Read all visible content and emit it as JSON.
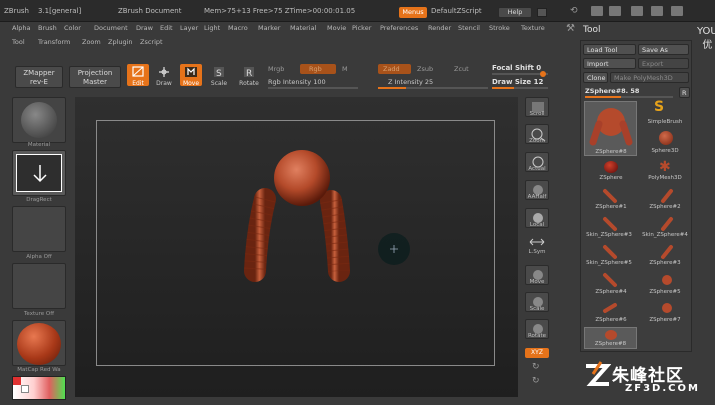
{
  "titlebar": {
    "app": "ZBrush",
    "version": "3.1[general]",
    "doc": "ZBrush Document",
    "mem": "Mem>75+13 Free>75 ZTime>00:00:01.05",
    "menus_btn": "Menus",
    "default_script": "DefaultZScript",
    "help": "Help"
  },
  "menubar": [
    "Alpha",
    "Brush",
    "Color",
    "Document",
    "Draw",
    "Edit",
    "Layer",
    "Light",
    "Macro",
    "Marker",
    "Material",
    "Movie",
    "Picker",
    "Preferences",
    "Render",
    "Stencil",
    "Stroke",
    "Texture"
  ],
  "submenu": [
    "Tool",
    "Transform",
    "Zoom",
    "Zplugin",
    "Zscript"
  ],
  "toolbar": {
    "zmapper": "ZMapper",
    "zmapper_sub": "rev-E",
    "projection": "Projection",
    "projection_sub": "Master",
    "edit": "Edit",
    "draw": "Draw",
    "move": "Move",
    "scale": "Scale",
    "rotate": "Rotate",
    "mrgb": "Mrgb",
    "rgb": "Rgb",
    "m": "M",
    "zadd": "Zadd",
    "zsub": "Zsub",
    "zcut": "Zcut",
    "rgb_intensity": "Rgb Intensity 100",
    "z_intensity": "Z Intensity 25",
    "focal_shift": "Focal Shift 0",
    "draw_size": "Draw Size 12"
  },
  "leftshelf": {
    "material_top": "Material",
    "dragrect": "DragRect",
    "alpha_off": "Alpha Off",
    "texture_off": "Texture Off",
    "matcap": "MatCap Red Wa"
  },
  "rightshelf": [
    "Scroll",
    "Zoom",
    "Actual",
    "AAHalf",
    "Local",
    "L.Sym",
    "Move",
    "Scale",
    "Rotate",
    "XYZ"
  ],
  "toolpanel": {
    "title": "Tool",
    "load": "Load Tool",
    "save": "Save As",
    "import": "Import",
    "export": "Export",
    "clone": "Clone",
    "make_polymesh": "Make PolyMesh3D",
    "current": "ZSphere#8. 58",
    "r": "R",
    "items": [
      {
        "label": "ZSphere#8",
        "kind": "big"
      },
      {
        "label": "SimpleBrush",
        "kind": "s"
      },
      {
        "label": "Sphere3D",
        "kind": "sphere"
      },
      {
        "label": "ZSphere",
        "kind": "zsphere"
      },
      {
        "label": "PolyMesh3D",
        "kind": "star"
      },
      {
        "label": "ZSphere#1",
        "kind": "limb"
      },
      {
        "label": "ZSphere#2",
        "kind": "limb"
      },
      {
        "label": "Skin_ZSphere#3",
        "kind": "limb"
      },
      {
        "label": "Skin_ZSphere#4",
        "kind": "limb"
      },
      {
        "label": "Skin_ZSphere#5",
        "kind": "limb"
      },
      {
        "label": "ZSphere#3",
        "kind": "limb"
      },
      {
        "label": "ZSphere#4",
        "kind": "limb"
      },
      {
        "label": "ZSphere#5",
        "kind": "limb"
      },
      {
        "label": "ZSphere#6",
        "kind": "limb"
      },
      {
        "label": "ZSphere#7",
        "kind": "limb"
      },
      {
        "label": "ZSphere#8",
        "kind": "sphere"
      }
    ]
  },
  "watermark": {
    "site": "朱峰社区",
    "url": "ZF3D.COM",
    "corner": "YOU 优"
  },
  "colors": {
    "accent": "#e6731a",
    "model": "#b54a2c"
  }
}
